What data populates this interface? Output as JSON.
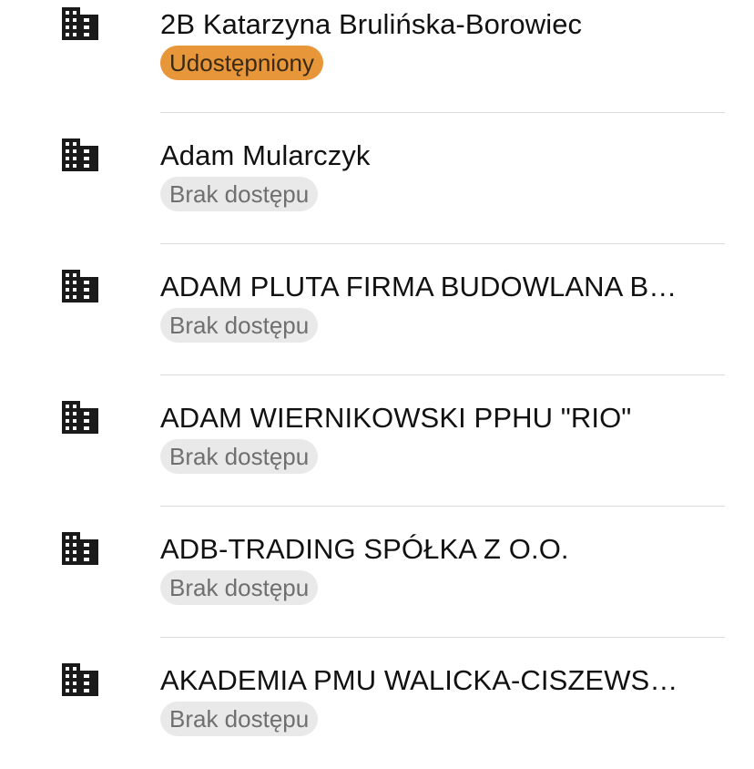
{
  "colors": {
    "shared_badge_bg": "#e8963a",
    "no_access_badge_bg": "#e9e9e9",
    "icon": "#1a1a1a"
  },
  "items": [
    {
      "icon": "building-icon",
      "name": "2B Katarzyna Brulińska-Borowiec",
      "status": "Udostępniony",
      "status_type": "shared"
    },
    {
      "icon": "building-icon",
      "name": "Adam Mularczyk",
      "status": "Brak dostępu",
      "status_type": "none"
    },
    {
      "icon": "building-icon",
      "name": "ADAM PLUTA FIRMA BUDOWLANA B…",
      "status": "Brak dostępu",
      "status_type": "none"
    },
    {
      "icon": "building-icon",
      "name": "ADAM WIERNIKOWSKI PPHU \"RIO\"",
      "status": "Brak dostępu",
      "status_type": "none"
    },
    {
      "icon": "building-icon",
      "name": "ADB-TRADING SPÓŁKA Z O.O.",
      "status": "Brak dostępu",
      "status_type": "none"
    },
    {
      "icon": "building-icon",
      "name": "AKADEMIA PMU WALICKA-CISZEWS…",
      "status": "Brak dostępu",
      "status_type": "none"
    }
  ]
}
